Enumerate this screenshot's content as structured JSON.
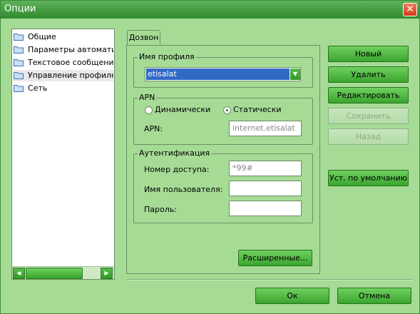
{
  "window": {
    "title": "Опции",
    "close_glyph": "✕"
  },
  "sidebar": {
    "items": [
      {
        "label": "Общие",
        "icon": "folder-icon"
      },
      {
        "label": "Параметры автоматического",
        "icon": "folder-icon"
      },
      {
        "label": "Текстовое сообщение",
        "icon": "folder-icon"
      },
      {
        "label": "Управление профилем",
        "icon": "folder-icon",
        "selected": true
      },
      {
        "label": "Сеть",
        "icon": "folder-icon"
      }
    ],
    "scroll_left": "◀",
    "scroll_right": "▶"
  },
  "tab": {
    "label": "Дозвон"
  },
  "profile_group": {
    "label": "Имя профиля",
    "selected": "etisalat",
    "dropdown_glyph": "▼"
  },
  "apn_group": {
    "label": "APN",
    "dynamic_label": "Динамически",
    "static_label": "Статически",
    "selected_mode": "Статически",
    "apn_label": "APN:",
    "apn_value": "internet.etisalat"
  },
  "auth_group": {
    "label": "Аутентификация",
    "number_label": "Номер доступа:",
    "number_value": "*99#",
    "user_label": "Имя пользователя:",
    "user_value": "",
    "password_label": "Пароль:",
    "password_value": ""
  },
  "buttons": {
    "new": "Новый",
    "delete": "Удалить",
    "edit": "Редактировать",
    "save": "Сохранить",
    "back": "Назад",
    "defaults": "Уст. по умолчанию",
    "advanced": "Расширенные...",
    "ok": "Ок",
    "cancel": "Отмена"
  },
  "colors": {
    "accent": "#3ba52f",
    "titlebar": "#2f8a2c",
    "selection": "#316ac5",
    "close": "#d23a1c"
  }
}
